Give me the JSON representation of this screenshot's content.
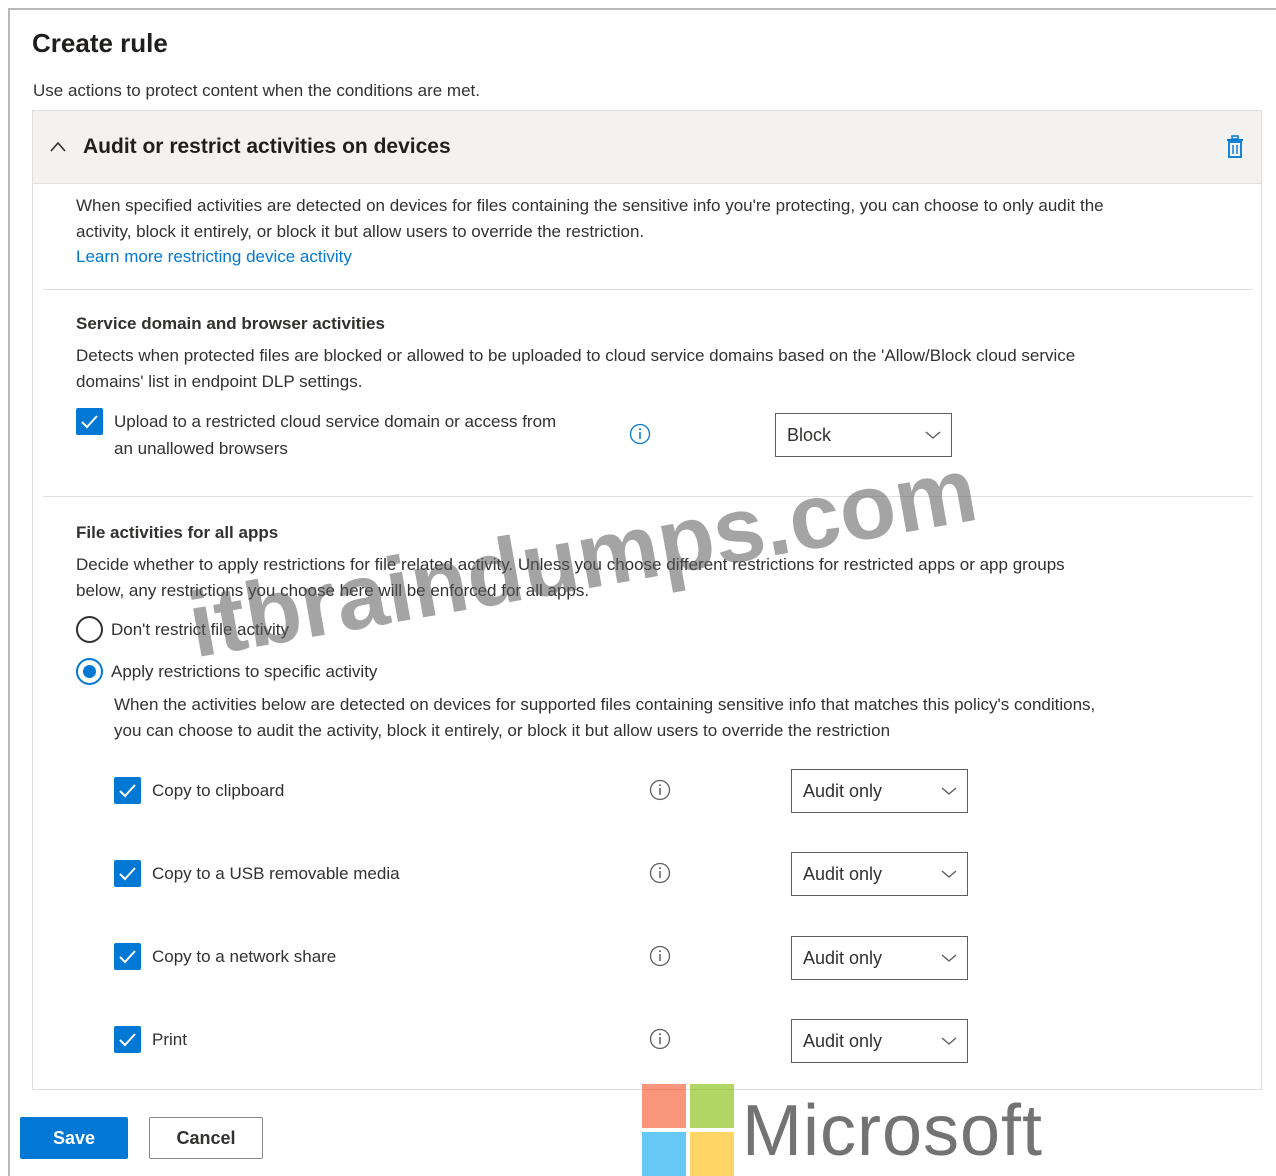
{
  "page": {
    "title": "Create rule",
    "subtitle": "Use actions to protect content when the conditions are met."
  },
  "section": {
    "title": "Audit or restrict activities on devices",
    "collapse_icon": "chevron-up-icon",
    "delete_icon": "trash-icon",
    "description_line1": "When specified activities are detected on devices for files containing the sensitive info you're protecting, you can choose to only audit the",
    "description_line2": "activity, block it entirely, or block it but allow users to override the restriction.",
    "learn_more": "Learn more restricting device activity"
  },
  "service_domain": {
    "heading": "Service domain and browser activities",
    "desc_line1": "Detects when protected files are blocked or allowed to be uploaded to cloud service domains based on the 'Allow/Block cloud service",
    "desc_line2": "domains' list in endpoint DLP settings.",
    "option_line1": "Upload to a restricted cloud service domain or access from",
    "option_line2": "an unallowed browsers",
    "option_checked": true,
    "option_value": "Block"
  },
  "file_activities": {
    "heading": "File activities for all apps",
    "desc_line1": "Decide whether to apply restrictions for file related activity. Unless you choose different restrictions for restricted apps or app groups",
    "desc_line2": "below, any restrictions you choose here will be enforced for all apps.",
    "radio_none": "Don't restrict file activity",
    "radio_apply": "Apply restrictions to specific activity",
    "selected_radio": "apply",
    "apply_desc_line1": "When the activities below are detected on devices for supported files containing sensitive info that matches this policy's conditions,",
    "apply_desc_line2": "you can choose to audit the activity, block it entirely, or block it but allow users to override the restriction",
    "activities": [
      {
        "label": "Copy to clipboard",
        "checked": true,
        "value": "Audit only"
      },
      {
        "label": "Copy to a USB removable media",
        "checked": true,
        "value": "Audit only"
      },
      {
        "label": "Copy to a network share",
        "checked": true,
        "value": "Audit only"
      },
      {
        "label": "Print",
        "checked": true,
        "value": "Audit only"
      }
    ]
  },
  "footer": {
    "save_label": "Save",
    "cancel_label": "Cancel"
  },
  "branding": {
    "watermark": "itbraindumps.com",
    "logo_word": "Microsoft",
    "logo_colors": [
      "#f25022",
      "#7fba00",
      "#00a4ef",
      "#ffb900"
    ]
  },
  "colors": {
    "accent": "#0078d4",
    "header_bg": "#f3f2f1"
  }
}
